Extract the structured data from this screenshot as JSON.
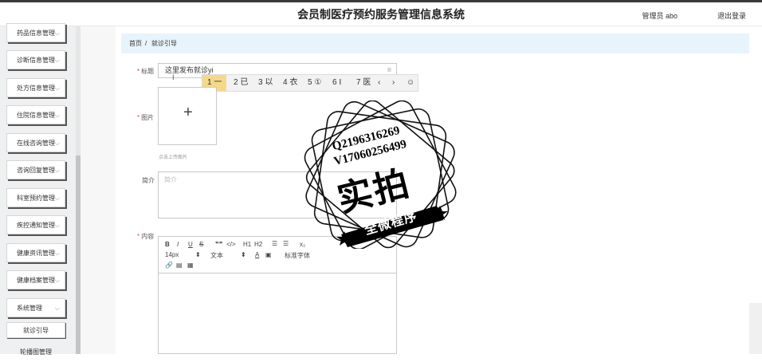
{
  "header": {
    "title": "会员制医疗预约服务管理信息系统",
    "admin_label": "管理员 abo",
    "logout_label": "退出登录"
  },
  "sidebar": {
    "items": [
      {
        "label": "药品信息管理"
      },
      {
        "label": "诊断信息管理"
      },
      {
        "label": "处方信息管理"
      },
      {
        "label": "住院信息管理"
      },
      {
        "label": "在线咨询管理"
      },
      {
        "label": "咨询回复管理"
      },
      {
        "label": "科室预约管理"
      },
      {
        "label": "疾控通知管理"
      },
      {
        "label": "健康资讯管理"
      },
      {
        "label": "健康档案管理"
      },
      {
        "label": "系统管理"
      },
      {
        "label": "就诊引导"
      },
      {
        "label": "轮播图管理"
      }
    ]
  },
  "breadcrumb": {
    "home": "首页",
    "sep": "/",
    "current": "就诊引导"
  },
  "form": {
    "title_label": "标题",
    "title_value": "这里发布就诊yi",
    "image_label": "图片",
    "upload_hint": "点击上传图片",
    "intro_label": "简介",
    "intro_placeholder": "简介",
    "content_label": "内容"
  },
  "ime": {
    "candidates": [
      "1 一",
      "2 已",
      "3 以",
      "4 衣",
      "5 ①",
      "6 Ⅰ",
      "7 医"
    ],
    "prev": "‹",
    "next": "›",
    "emoji": "☺"
  },
  "editor": {
    "font_size": "14px",
    "text_style": "文本",
    "font_family": "标准字体",
    "h1": "H1",
    "h2": "H2"
  },
  "watermark": {
    "line1": "Q2196316269",
    "line2": "V17060256499",
    "main": "实拍",
    "ribbon": "全微程序"
  },
  "colors": {
    "breadcrumb_bg": "#e8f4fb",
    "ime_selected": "#f5d88a",
    "required": "#e04848"
  }
}
